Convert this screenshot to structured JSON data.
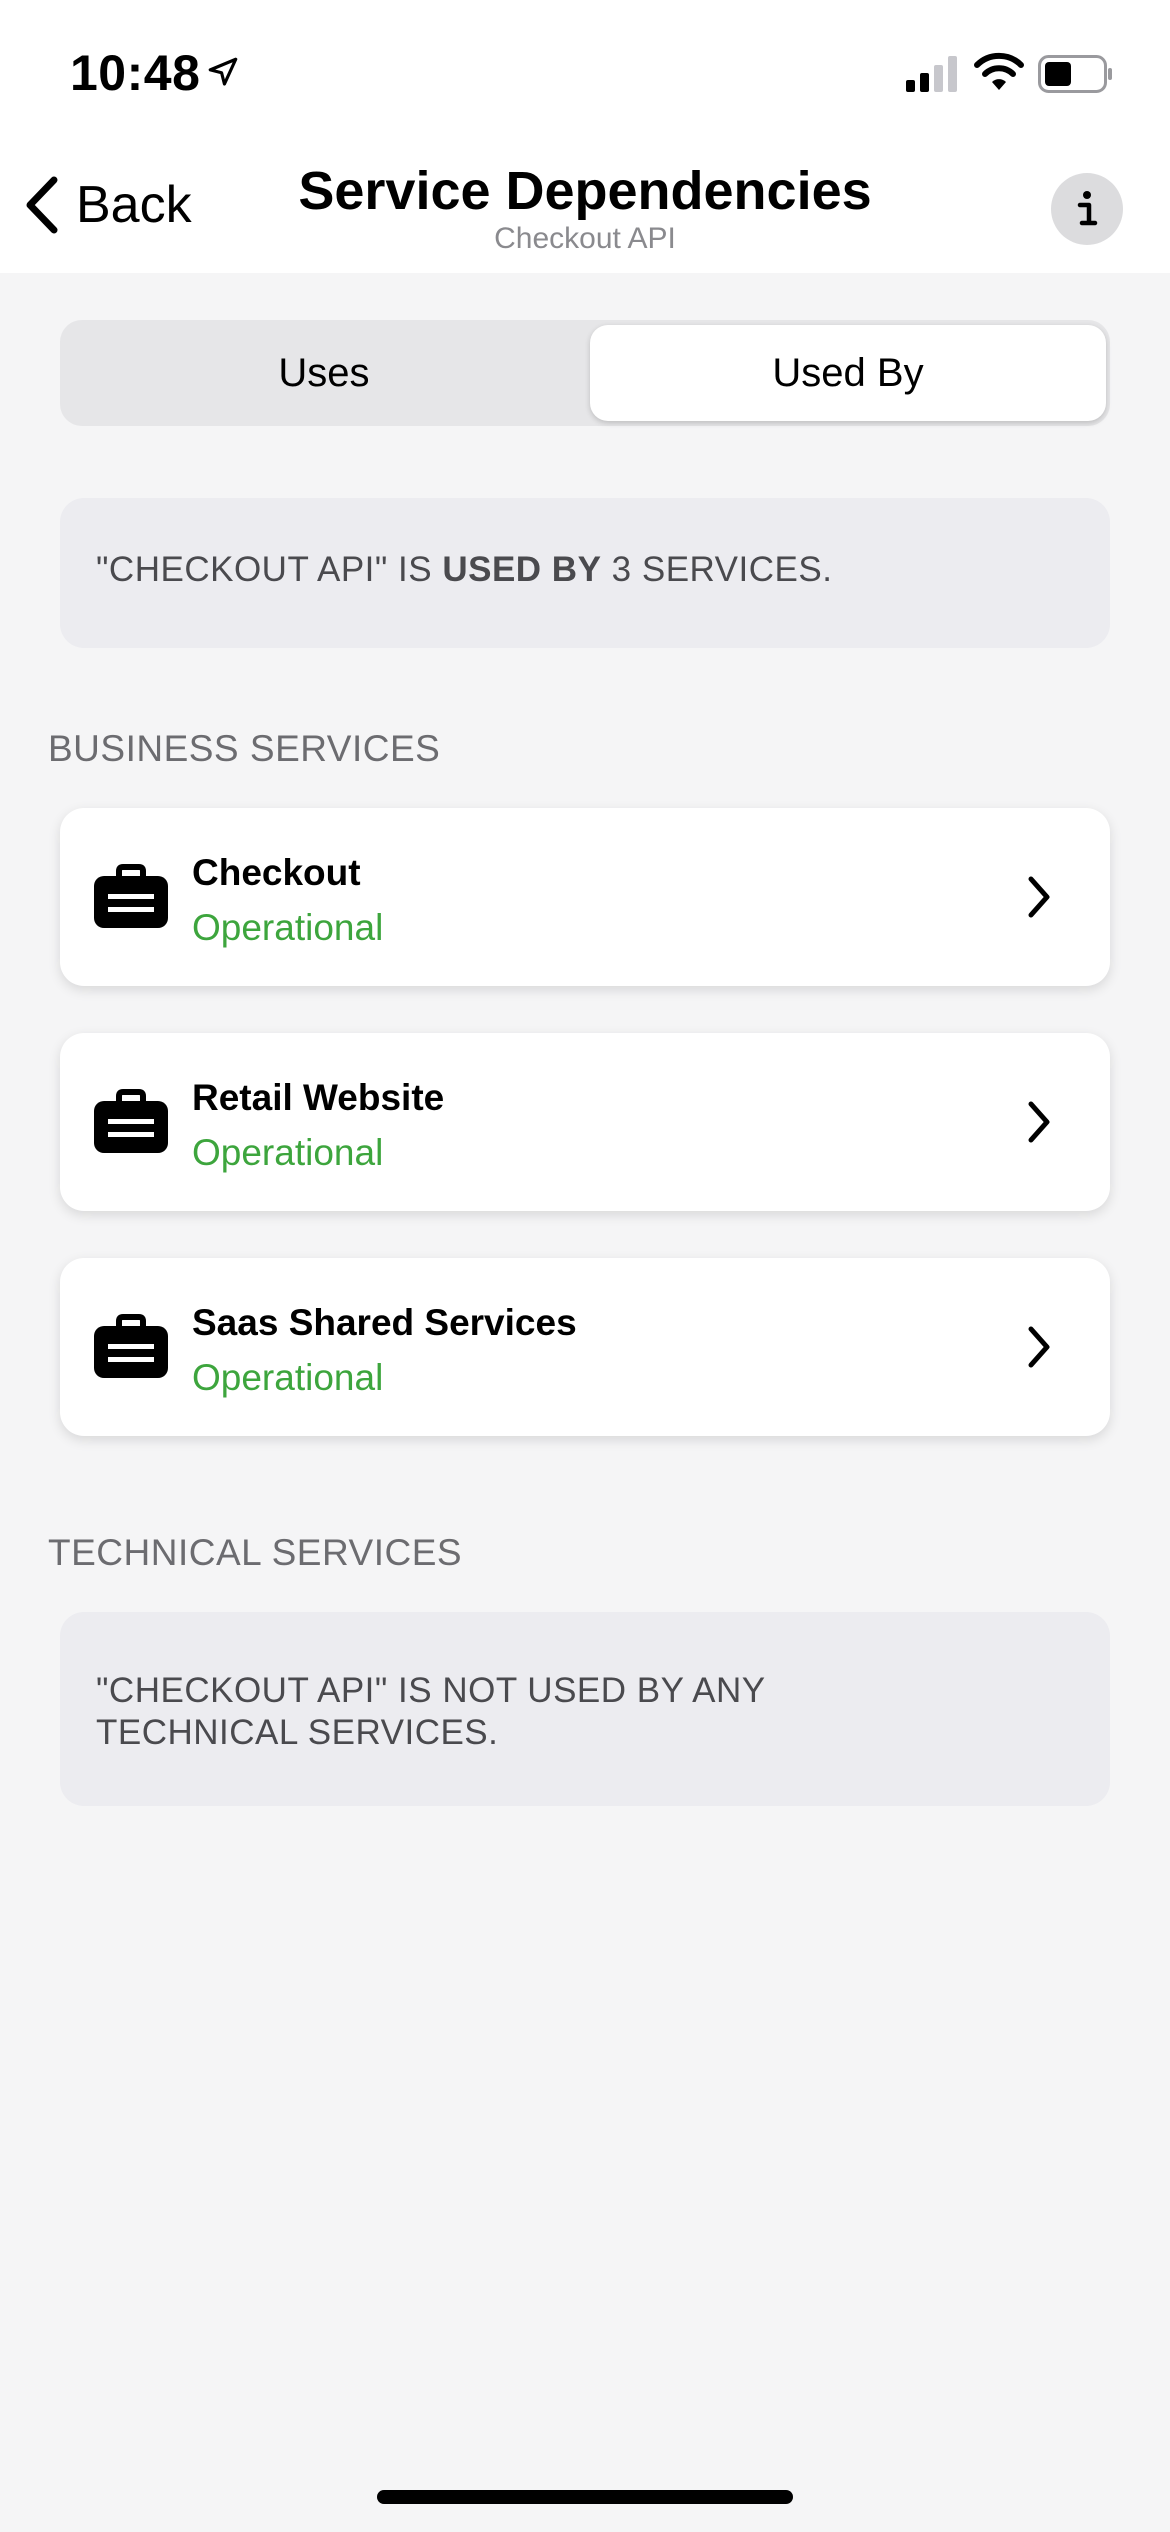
{
  "status_bar": {
    "time": "10:48"
  },
  "nav": {
    "back_label": "Back",
    "title": "Service Dependencies",
    "subtitle": "Checkout API"
  },
  "tabs": [
    {
      "label": "Uses",
      "selected": false
    },
    {
      "label": "Used By",
      "selected": true
    }
  ],
  "summary": {
    "prefix": "\"CHECKOUT API\" IS ",
    "emphasis": "USED BY",
    "suffix": " 3 SERVICES."
  },
  "business": {
    "header": "BUSINESS SERVICES",
    "items": [
      {
        "name": "Checkout",
        "status": "Operational"
      },
      {
        "name": "Retail Website",
        "status": "Operational"
      },
      {
        "name": "Saas Shared Services",
        "status": "Operational"
      }
    ]
  },
  "technical": {
    "header": "TECHNICAL SERVICES",
    "empty_message": "\"CHECKOUT API\" IS NOT USED BY ANY TECHNICAL SERVICES."
  },
  "colors": {
    "status_operational": "#3da53d",
    "background": "#f5f5f6"
  },
  "icons": {
    "location": "location-arrow-icon",
    "signal": "cellular-signal-icon",
    "wifi": "wifi-icon",
    "battery": "battery-icon",
    "back": "chevron-left-icon",
    "info": "info-icon",
    "service": "briefcase-icon",
    "row_action": "chevron-right-icon"
  }
}
